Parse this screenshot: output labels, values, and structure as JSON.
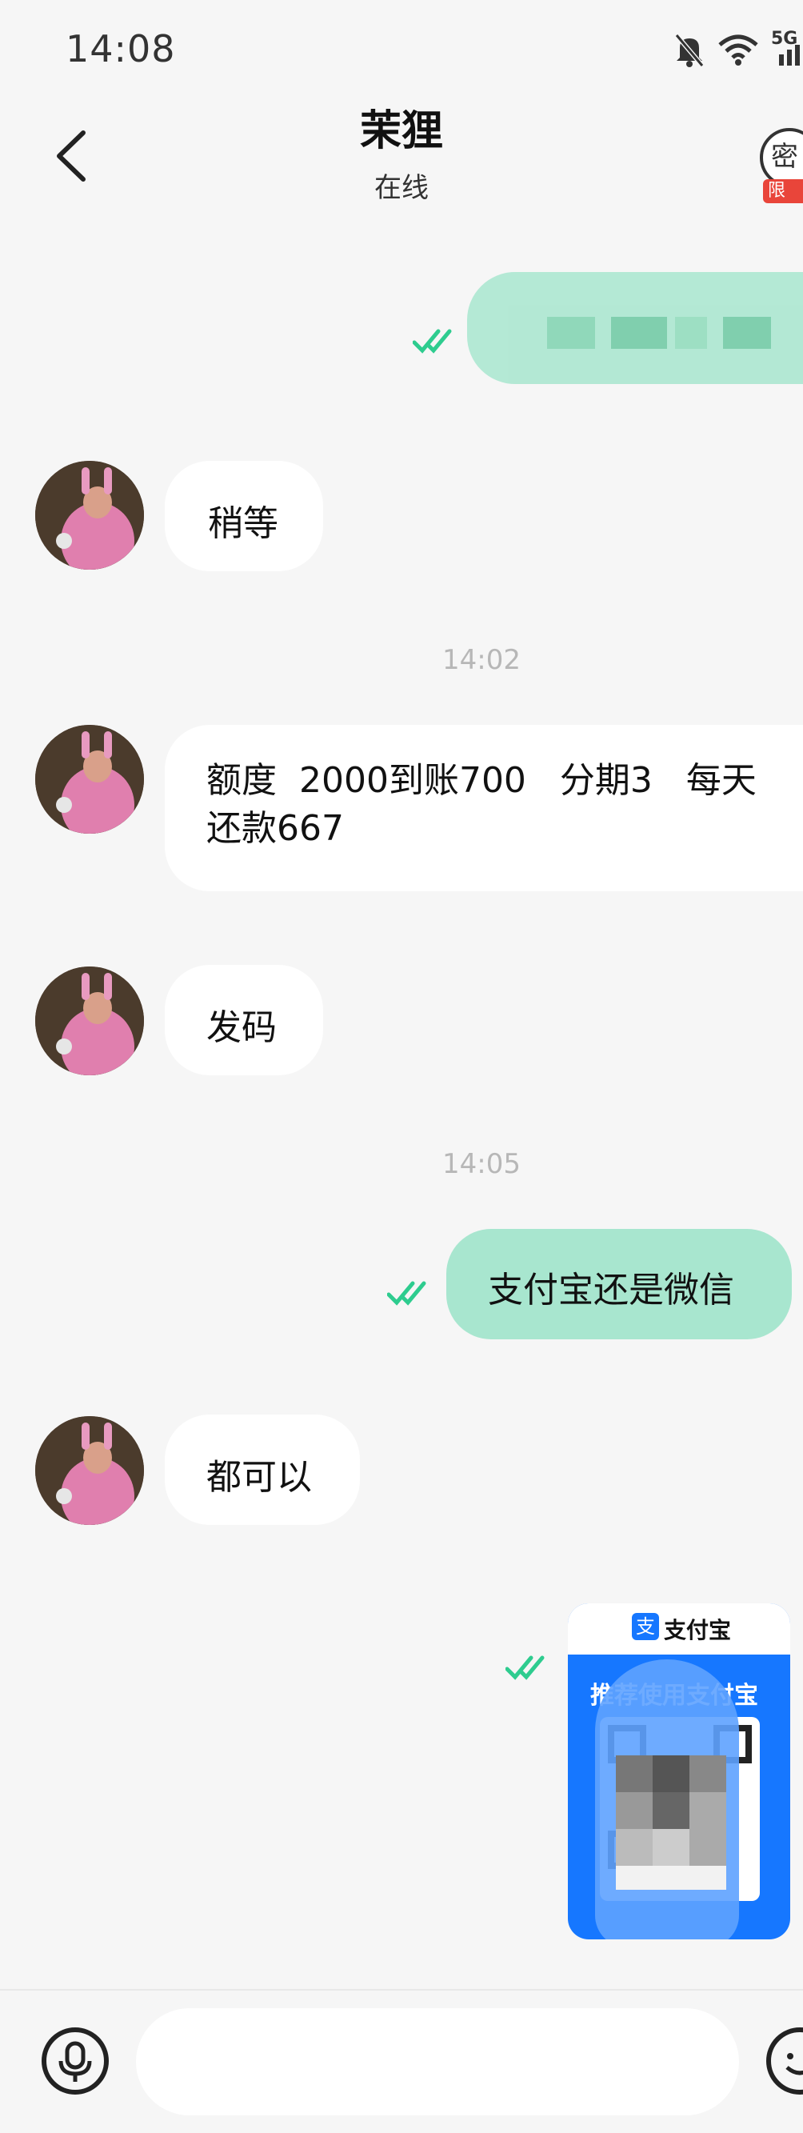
{
  "status_bar": {
    "time": "14:08",
    "network": "5G"
  },
  "header": {
    "title": "茉狸",
    "subtitle": "在线",
    "top_right_icon": "密",
    "badge": "限"
  },
  "messages": {
    "m2": {
      "text": "稍等"
    },
    "t1": {
      "text": "14:02"
    },
    "m3": {
      "line1": "额度  2000到账700   分期3   每天",
      "line2": "还款667"
    },
    "m4": {
      "text": "发码"
    },
    "t2": {
      "text": "14:05"
    },
    "m5": {
      "text": "支付宝还是微信"
    },
    "m6": {
      "text": "都可以"
    },
    "qr": {
      "brand": "支付宝",
      "banner": "推荐使用支付宝"
    }
  },
  "input": {
    "placeholder": ""
  },
  "colors": {
    "outgoing_bubble": "#a8e6cf",
    "incoming_bubble": "#ffffff",
    "ticks": "#2ecc8f",
    "alipay": "#1677ff"
  }
}
